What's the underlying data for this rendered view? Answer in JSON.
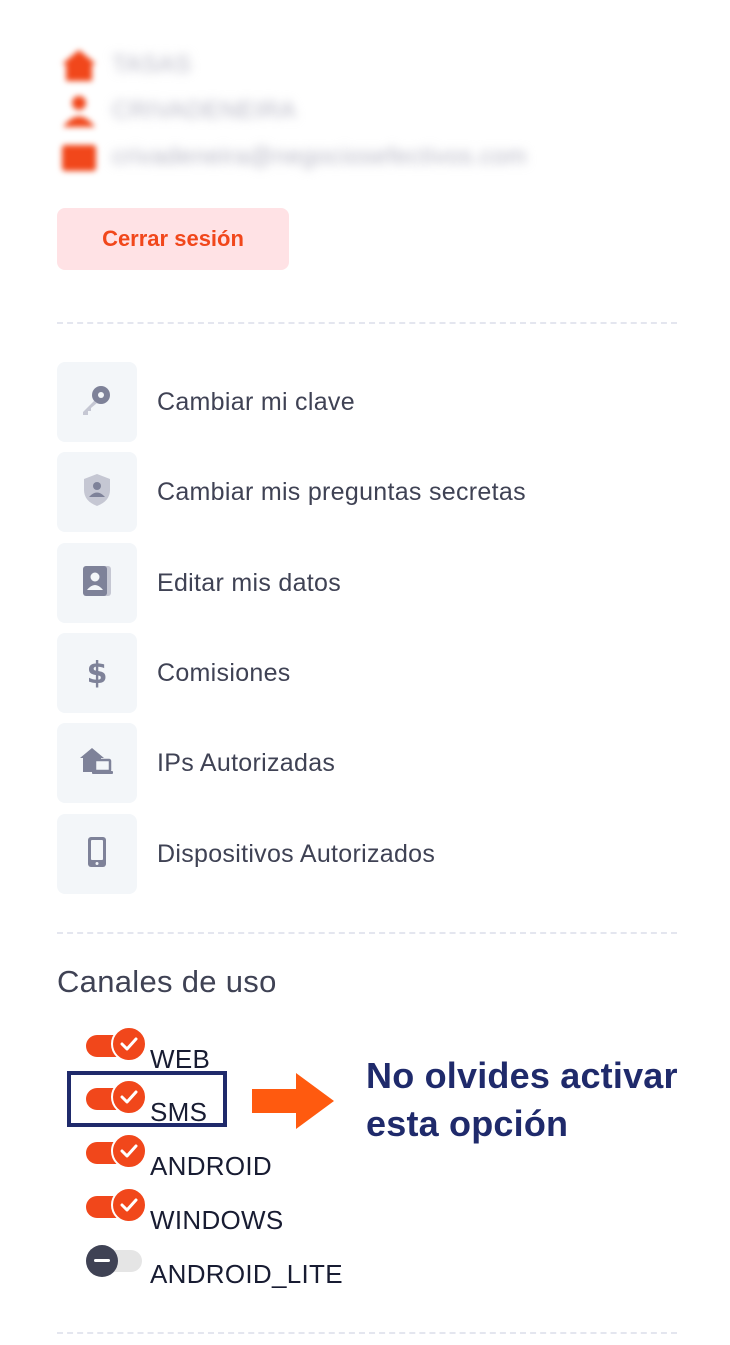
{
  "profile": {
    "company": "TASAS",
    "name": "CRIVADENEIRA",
    "email": "crivadeneira@negociosefectivos.com"
  },
  "logout": {
    "label": "Cerrar sesión"
  },
  "menu": {
    "items": [
      {
        "label": "Cambiar mi clave",
        "icon": "key-icon"
      },
      {
        "label": "Cambiar mis preguntas secretas",
        "icon": "shield-user-icon"
      },
      {
        "label": "Editar mis datos",
        "icon": "contact-card-icon"
      },
      {
        "label": "Comisiones",
        "icon": "dollar-icon"
      },
      {
        "label": "IPs Autorizadas",
        "icon": "home-computer-icon"
      },
      {
        "label": "Dispositivos Autorizados",
        "icon": "mobile-icon"
      }
    ]
  },
  "channels": {
    "title": "Canales de uso",
    "items": [
      {
        "label": "WEB",
        "enabled": true
      },
      {
        "label": "SMS",
        "enabled": true
      },
      {
        "label": "ANDROID",
        "enabled": true
      },
      {
        "label": "WINDOWS",
        "enabled": true
      },
      {
        "label": "ANDROID_LITE",
        "enabled": false
      }
    ]
  },
  "annotation": {
    "line1": "No olvides activar",
    "line2": "esta opción",
    "color": "#1f2a6b",
    "arrow_color": "#ff5a0f"
  },
  "colors": {
    "accent": "#f1471b",
    "accent_light": "#ffe2e5",
    "icon_bg": "#f3f6f9",
    "text": "#3f4254"
  }
}
